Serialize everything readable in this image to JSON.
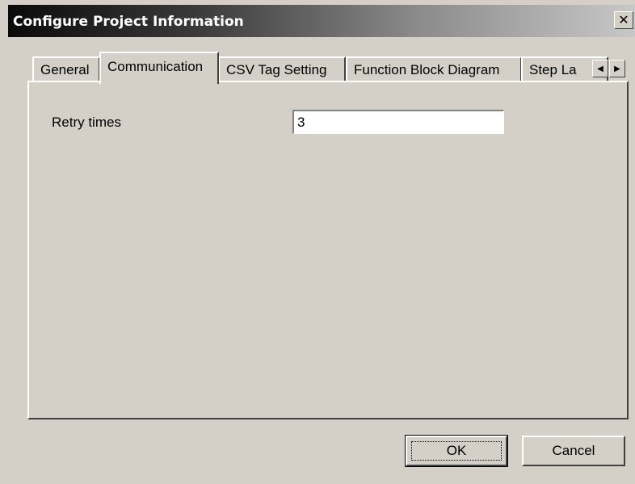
{
  "window": {
    "title": "Configure Project Information",
    "close_glyph": "✕"
  },
  "tabs": [
    {
      "label": "General",
      "active": false
    },
    {
      "label": "Communication",
      "active": true
    },
    {
      "label": "CSV Tag Setting",
      "active": false
    },
    {
      "label": "Function Block Diagram",
      "active": false
    },
    {
      "label": "Step La",
      "active": false
    }
  ],
  "tab_scroll": {
    "left_icon": "triangle-left-icon",
    "right_icon": "triangle-right-icon",
    "left_glyph": "◀",
    "right_glyph": "▶"
  },
  "communication": {
    "retry_label": "Retry times",
    "retry_value": "3"
  },
  "buttons": {
    "ok_label": "OK",
    "cancel_label": "Cancel"
  },
  "colors": {
    "face": "#d4d0c8",
    "title_gradient_start": "#0a0a0a",
    "title_gradient_end": "#c8c8c8",
    "title_text": "#ffffff"
  }
}
